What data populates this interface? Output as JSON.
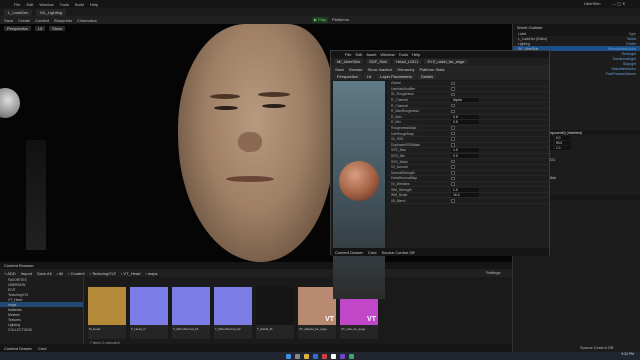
{
  "window": {
    "title": "UberSkin",
    "level": "L_LookDev",
    "tab2": "ML_Lighting"
  },
  "menu": [
    "File",
    "Edit",
    "Window",
    "Tools",
    "Build",
    "Help"
  ],
  "toolbar": {
    "items": [
      "Save",
      "Create",
      "Content",
      "Blueprints",
      "Cinematics"
    ],
    "play": "Play",
    "platforms": "Platforms"
  },
  "viewport": {
    "btns": [
      "Perspective",
      "Lit",
      "Show"
    ]
  },
  "material": {
    "title": "MI_UberSkin",
    "menu": [
      "File",
      "Edit",
      "Asset",
      "Window",
      "Tools",
      "Help"
    ],
    "tabs": [
      "MI_UberSkin",
      "SDF_Skin",
      "Head_LOD1",
      "SYZ_uskin_be_ange"
    ],
    "tools": [
      "Save",
      "Browse",
      "Show Inactive",
      "Hierarchy",
      "Platform Stats"
    ],
    "subtabs": [
      "Perspective",
      "Lit",
      "Layer Parameters",
      "Details"
    ],
    "rows": [
      {
        "label": "Global",
        "v": ""
      },
      {
        "label": "UseHairModifier",
        "v": ""
      },
      {
        "label": "01_Roughness",
        "v": ""
      },
      {
        "label": "R_Channel",
        "v": "Alpha"
      },
      {
        "label": "R_Channel",
        "v": ""
      },
      {
        "label": "R_MaxRoughness",
        "v": ""
      },
      {
        "label": "R_Max",
        "v": "0.6"
      },
      {
        "label": "R_Min",
        "v": "0.5"
      },
      {
        "label": "RoughnessMask",
        "v": ""
      },
      {
        "label": "UseRoughMap",
        "v": ""
      },
      {
        "label": "02_SSS",
        "v": ""
      },
      {
        "label": "DuplicateSSSMask",
        "v": ""
      },
      {
        "label": "SSS_Max",
        "v": "1.0"
      },
      {
        "label": "SSS_Min",
        "v": "0.0"
      },
      {
        "label": "SSS_Mask",
        "v": ""
      },
      {
        "label": "03_Normal",
        "v": ""
      },
      {
        "label": "NormalStrength",
        "v": ""
      },
      {
        "label": "DetailNormalMap",
        "v": ""
      },
      {
        "label": "04_Wrinkles",
        "v": ""
      },
      {
        "label": "WM_Strength",
        "v": "1.0"
      },
      {
        "label": "WM_Scale",
        "v": "16.0"
      },
      {
        "label": "05_Blend",
        "v": ""
      }
    ],
    "status": [
      "Content Drawer",
      "Cmd",
      "Source Control Off"
    ]
  },
  "outliner": {
    "title": "World Outliner",
    "header": [
      "Label",
      "Type"
    ],
    "rows": [
      {
        "l": "L_LookDev (Editor)",
        "t": "World"
      },
      {
        "l": "Lighting",
        "t": "Folder"
      },
      {
        "l": "SK_UberSkin",
        "t": "SkeletalMeshActor"
      },
      {
        "l": "Rect Light",
        "t": "RectLight"
      },
      {
        "l": "Directional Light",
        "t": "DirectionalLight"
      },
      {
        "l": "SkyLight",
        "t": "SkyLight"
      },
      {
        "l": "Backdrop",
        "t": "StaticMeshActor"
      },
      {
        "l": "PostProcessVolume",
        "t": "PostProcessVolume"
      }
    ]
  },
  "details": {
    "component": "Mesh (StaticMeshComponent0) (Inherited)",
    "transform": [
      [
        "0.0",
        "0.0",
        "0.0"
      ],
      [
        "0.0",
        "0.0",
        "90.0"
      ],
      [
        "1.0",
        "1.0",
        "1.0"
      ]
    ],
    "materials": [
      "Head_LOD1",
      "MI_UberSkin"
    ],
    "element": "Element 0",
    "physics": "PHYSICS",
    "physrows": [
      "Simulate Physics",
      "Mass (kg)",
      "Linear Damping",
      "Angular Damping",
      "Lock Position",
      "Lock Rotation"
    ]
  },
  "contentBrowser": {
    "tab": "Content Browser",
    "tools": [
      "+ ADD",
      "Import",
      "Save All"
    ],
    "path": [
      "All",
      "Content",
      "TexturingXYZ",
      "VT_Head",
      "maps"
    ],
    "settings": "Settings",
    "tree": [
      "FAVORITES",
      "UBERSKIN",
      "EDIT",
      "TexturingXYZ",
      "VT_Head",
      "maps",
      "Materials",
      "Meshes",
      "Textures",
      "Lighting",
      "COLLECTIONS"
    ],
    "count": "7 items (1 selected)",
    "assets": [
      {
        "name": "M_Head",
        "color": "#b58a3a",
        "vt": false
      },
      {
        "name": "T_Head_N",
        "color": "#7d7de8",
        "vt": false
      },
      {
        "name": "T_MicroNormal_01",
        "color": "#7d7de8",
        "vt": false
      },
      {
        "name": "T_MicroNormal_02",
        "color": "#7d7de8",
        "vt": false
      },
      {
        "name": "T_Detail_M",
        "color": "#151515",
        "vt": false
      },
      {
        "name": "VT_albedo_be_ange",
        "color": "#b98a72",
        "vt": true
      },
      {
        "name": "VT_utile_be_ange",
        "color": "#c048c8",
        "vt": true
      }
    ]
  },
  "status": {
    "drawer": "Content Drawer",
    "cmd": "Cmd",
    "src": "Source Control Off"
  },
  "taskbar": {
    "time": "9:32 PM",
    "date": "1/7/2022"
  }
}
